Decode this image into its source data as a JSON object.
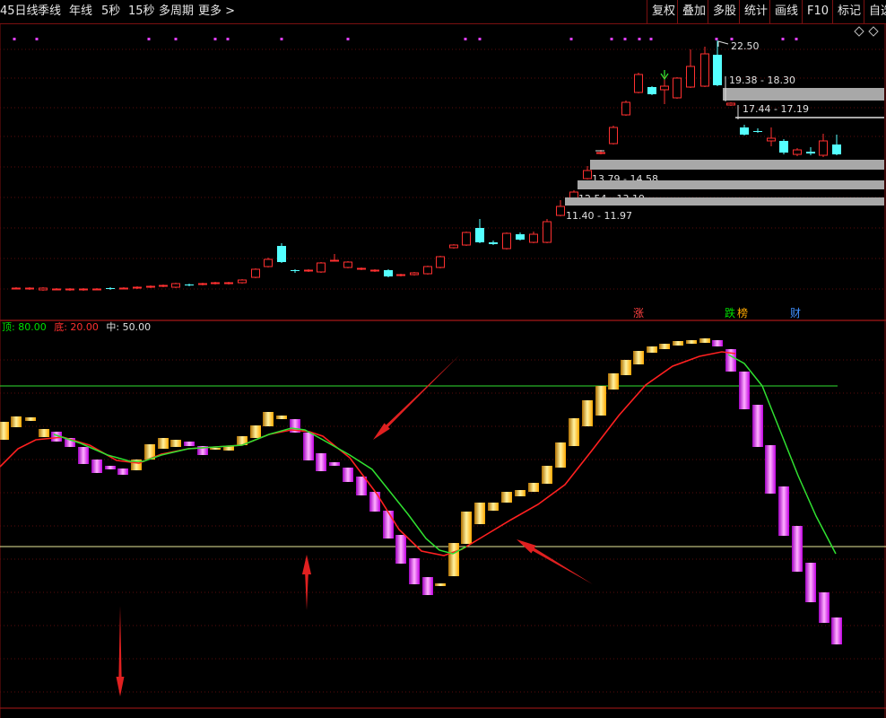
{
  "toolbar": {
    "left": [
      "45日线",
      "季线",
      "年线",
      "5秒",
      "15秒",
      "多周期",
      "更多 >"
    ],
    "right": [
      "复权",
      "叠加",
      "多股",
      "统计",
      "画线",
      "F10",
      "标记",
      "自选"
    ],
    "diamond_icon": "diamond-icon"
  },
  "price_chart": {
    "high_label": "22.50",
    "ranges": [
      "19.38 - 18.30",
      "17.44 - 17.19",
      "13.79 - 14.58",
      "12.54 - 13.19",
      "11.40 - 11.97"
    ],
    "event_tags": [
      {
        "text": "涨",
        "color": "#ff4040"
      },
      {
        "text": "跌",
        "color": "#00e000"
      },
      {
        "text": "榜",
        "color": "#ffaa00"
      },
      {
        "text": "财",
        "color": "#4090ff"
      }
    ],
    "up_color": "#ff3030",
    "down_color": "#54ffff"
  },
  "indicator": {
    "legend": [
      {
        "label": "顶: 80.00",
        "color": "#00e000"
      },
      {
        "label": "底: 20.00",
        "color": "#ff3030"
      },
      {
        "label": "中: 50.00",
        "color": "#e0e0e0"
      }
    ],
    "top_level": 80,
    "bottom_level": 20,
    "mid_level": 50,
    "bar_up_color": "#ffc000",
    "bar_down_color": "#e040ff",
    "fast_line_color": "#30e030",
    "slow_line_color": "#ff2020",
    "level_line_color": "#30e030",
    "annotation_color": "#e02020"
  }
}
